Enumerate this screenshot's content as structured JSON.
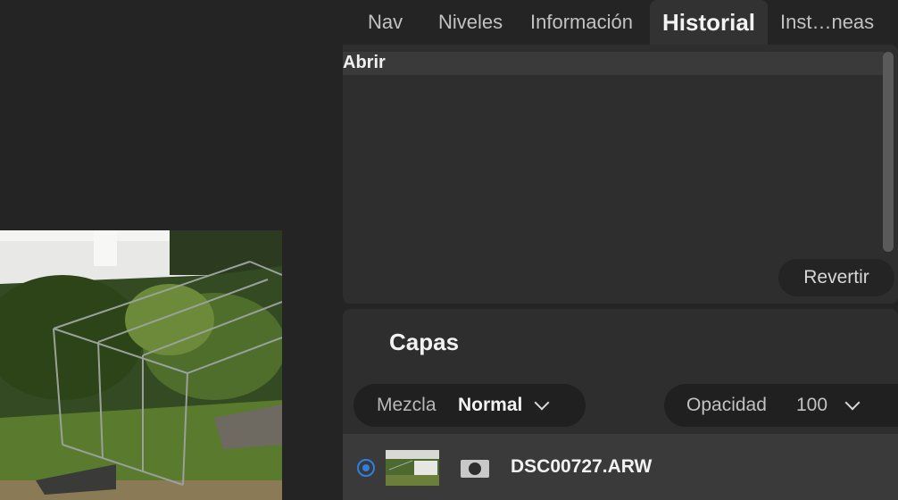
{
  "tabs": [
    {
      "label": "Nav",
      "active": false
    },
    {
      "label": "Niveles",
      "active": false
    },
    {
      "label": "Información",
      "active": false
    },
    {
      "label": "Historial",
      "active": true
    },
    {
      "label": "Inst…neas",
      "active": false
    }
  ],
  "history": {
    "items": [
      {
        "label": "Abrir",
        "selected": true
      }
    ],
    "revert_label": "Revertir"
  },
  "layers": {
    "title": "Capas",
    "blend": {
      "label": "Mezcla",
      "value": "Normal"
    },
    "opacity": {
      "label": "Opacidad",
      "value": "100"
    },
    "rows": [
      {
        "name": "DSC00727.ARW",
        "selected": true
      }
    ]
  },
  "colors": {
    "background": "#242424",
    "panel": "#2e2e2e",
    "selection": "#3a3a3a",
    "accent": "#2f7fe0"
  },
  "icons": [
    "chevron-down-icon",
    "mask-icon",
    "radio-selected-icon"
  ]
}
